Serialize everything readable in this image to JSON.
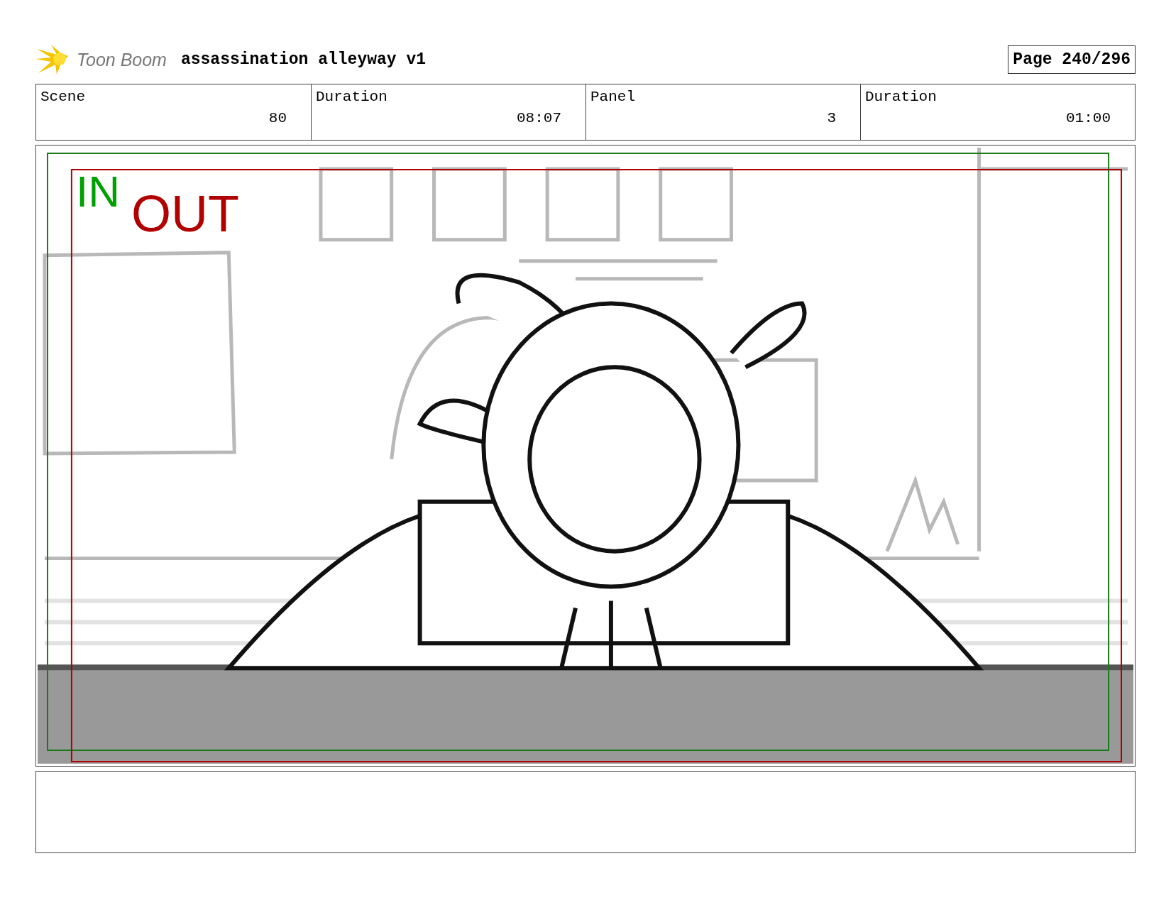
{
  "header": {
    "logo_text": "Toon Boom",
    "project_title": "assassination alleyway v1",
    "page": "Page 240/296"
  },
  "info": [
    {
      "label": "Scene",
      "value": "80"
    },
    {
      "label": "Duration",
      "value": "08:07"
    },
    {
      "label": "Panel",
      "value": "3"
    },
    {
      "label": "Duration",
      "value": "01:00"
    }
  ],
  "panel": {
    "frame_labels": [
      {
        "kind": "in",
        "text": "IN",
        "color": "#00a000"
      },
      {
        "kind": "out",
        "text": "OUT",
        "color": "#b00000"
      }
    ]
  }
}
